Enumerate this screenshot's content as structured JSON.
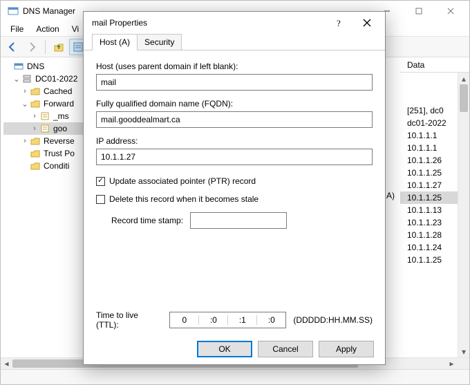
{
  "window": {
    "title": "DNS Manager",
    "menu": {
      "file": "File",
      "action": "Action",
      "view": "Vi"
    }
  },
  "tree": {
    "root": "DNS",
    "server": "DC01-2022",
    "cached": "Cached",
    "forward": "Forward",
    "msdcs": "_ms",
    "gooddeal": "goo",
    "reverse": "Reverse",
    "trust": "Trust Po",
    "conditional": "Conditi"
  },
  "right": {
    "header": "Data",
    "rows": [
      "[251], dc0",
      "dc01-2022",
      "10.1.1.1",
      "10.1.1.1",
      "10.1.1.26",
      "10.1.1.25",
      "10.1.1.27",
      "10.1.1.25",
      "10.1.1.13",
      "10.1.1.23",
      "10.1.1.28",
      "10.1.1.24",
      "10.1.1.25"
    ]
  },
  "mid_fragment": "A)",
  "dialog": {
    "title": "mail Properties",
    "tabs": {
      "host": "Host (A)",
      "security": "Security"
    },
    "labels": {
      "host": "Host (uses parent domain if left blank):",
      "fqdn": "Fully qualified domain name (FQDN):",
      "ip": "IP address:",
      "ptr": "Update associated pointer (PTR) record",
      "stale": "Delete this record when it becomes stale",
      "stamp": "Record time stamp:",
      "ttl": "Time to live (TTL):",
      "ttl_format": "(DDDDD:HH.MM.SS)"
    },
    "values": {
      "host": "mail",
      "fqdn": "mail.gooddealmart.ca",
      "ip": "10.1.1.27",
      "ptr_checked": true,
      "stale_checked": false,
      "stamp": "",
      "ttl": {
        "d": "0",
        "h": ":0",
        "m": ":1",
        "s": ":0"
      }
    },
    "buttons": {
      "ok": "OK",
      "cancel": "Cancel",
      "apply": "Apply"
    }
  }
}
